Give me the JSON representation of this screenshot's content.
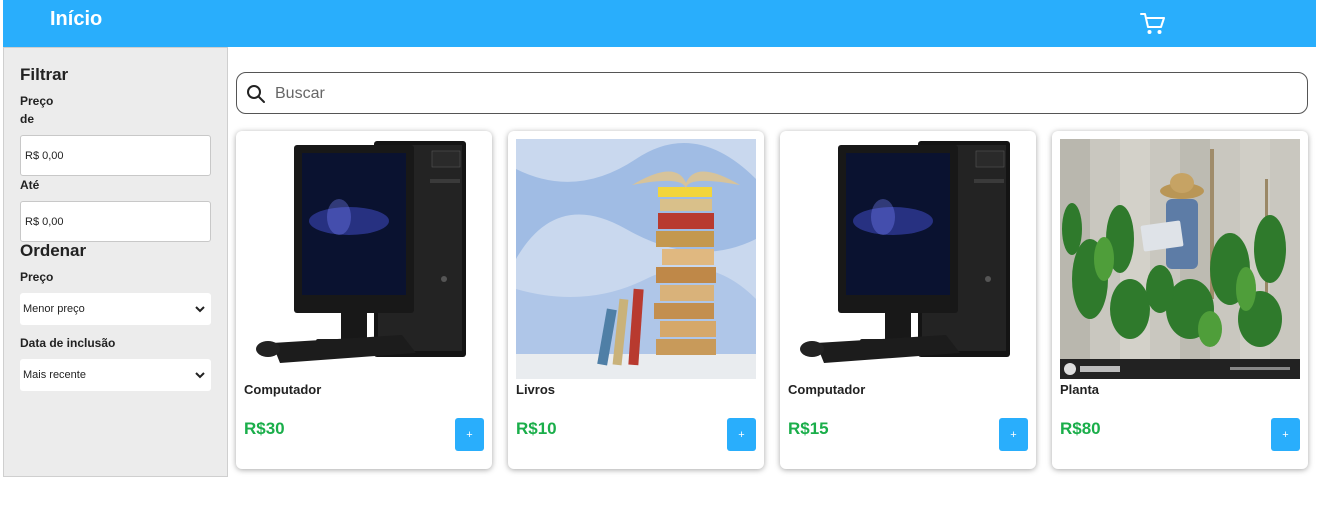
{
  "header": {
    "title": "Início",
    "cart_icon": "cart-icon"
  },
  "sidebar": {
    "filter_heading": "Filtrar",
    "price_label": "Preço",
    "from_label": "de",
    "from_value": "R$ 0,00",
    "to_label": "Até",
    "to_value": "R$ 0,00",
    "sort_heading": "Ordenar",
    "sort_price_label": "Preço",
    "sort_price_value": "Menor preço",
    "sort_date_label": "Data de inclusão",
    "sort_date_value": "Mais recente"
  },
  "search": {
    "placeholder": "Buscar"
  },
  "products": [
    {
      "name": "Computador",
      "price": "R$30",
      "add_label": "+"
    },
    {
      "name": "Livros",
      "price": "R$10",
      "add_label": "+"
    },
    {
      "name": "Computador",
      "price": "R$15",
      "add_label": "+"
    },
    {
      "name": "Planta",
      "price": "R$80",
      "add_label": "+"
    }
  ],
  "colors": {
    "accent": "#29aefc",
    "price": "#1aae4a",
    "sidebar_bg": "#ececec"
  }
}
